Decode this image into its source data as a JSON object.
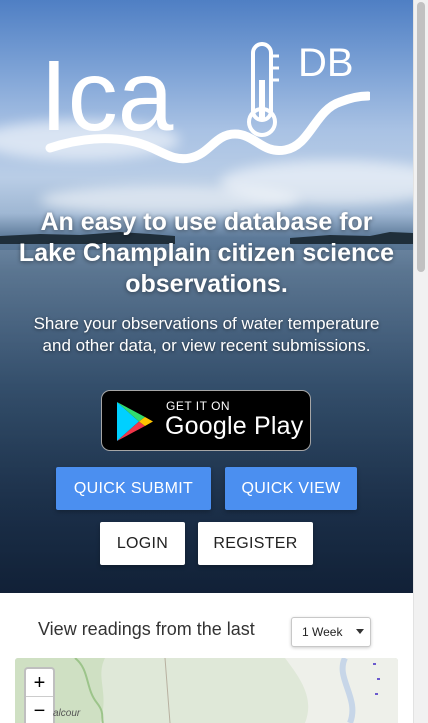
{
  "hero": {
    "logo_text_left": "Ica",
    "logo_text_db": "DB",
    "headline": "An easy to use database for Lake Champlain citizen science observations.",
    "subhead": "Share your observations of water temperature and other data, or view recent submissions.",
    "play_badge": {
      "top": "GET IT ON",
      "bottom": "Google Play"
    }
  },
  "buttons": {
    "quick_submit": "QUICK SUBMIT",
    "quick_view": "QUICK VIEW",
    "login": "LOGIN",
    "register": "REGISTER"
  },
  "readings": {
    "label": "View readings from the last",
    "range_selected": "1 Week"
  },
  "map": {
    "zoom_in": "+",
    "zoom_out": "−",
    "place_label": "alcour"
  },
  "colors": {
    "primary_button": "#4b8ff0",
    "light_button": "#ffffff"
  }
}
